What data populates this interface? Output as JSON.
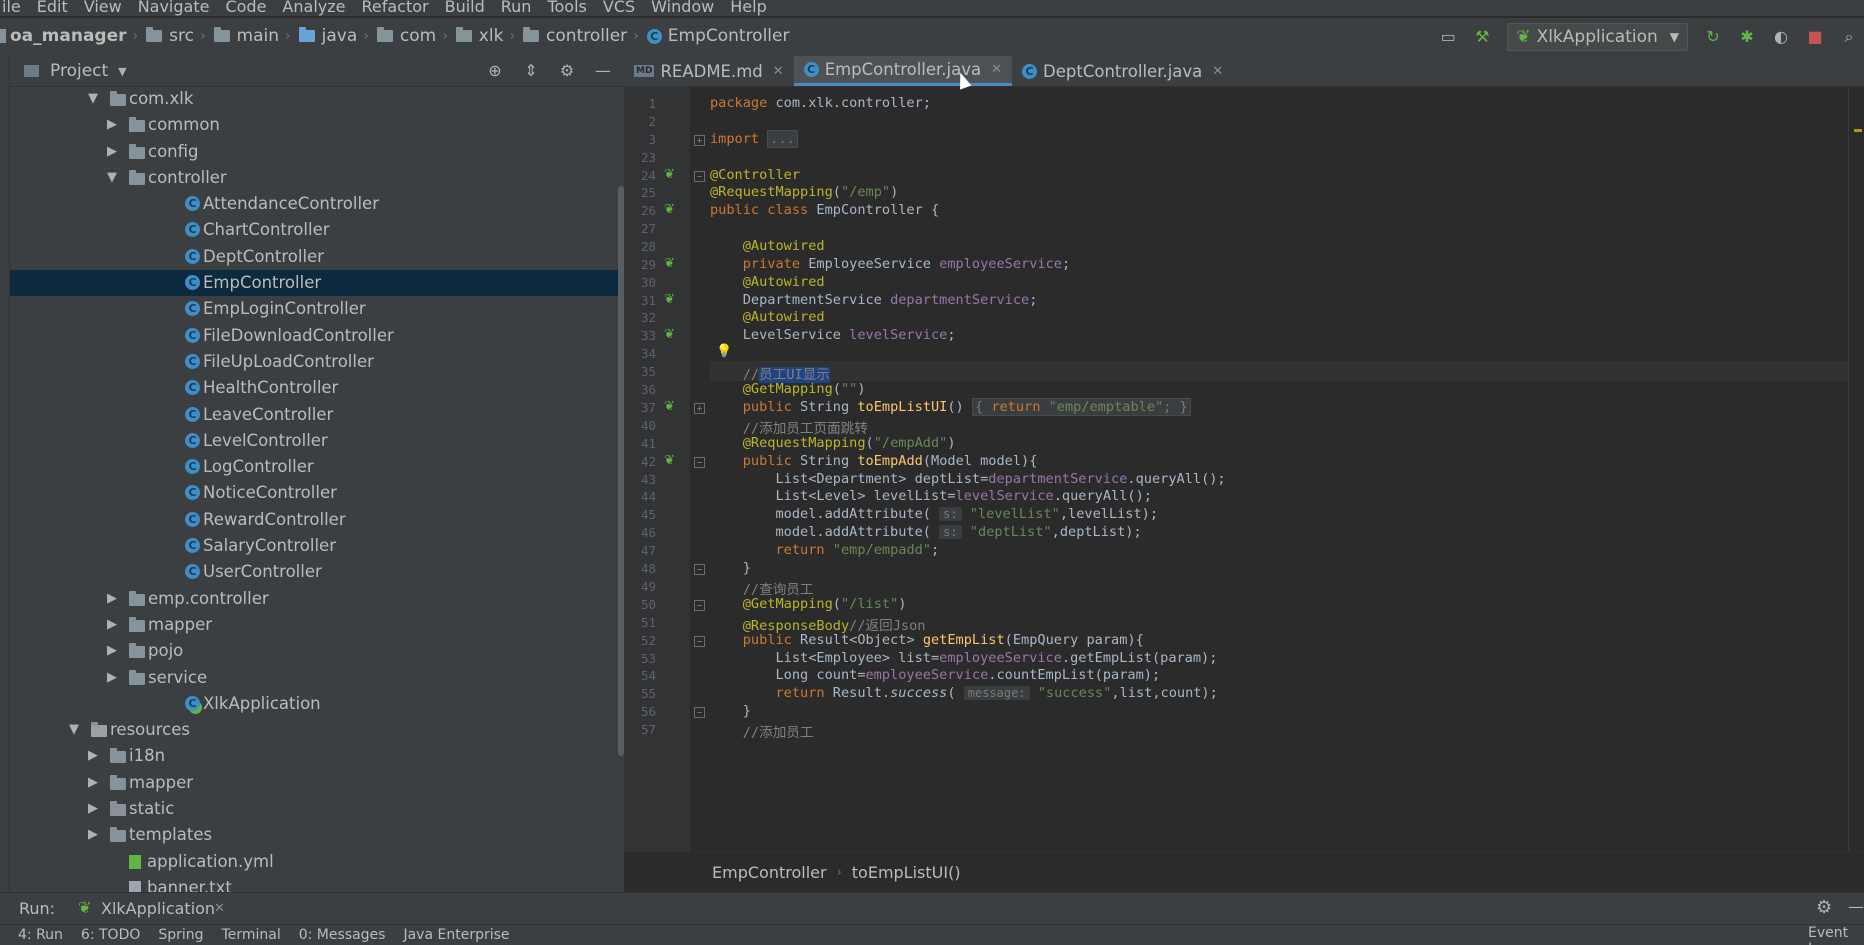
{
  "menu": [
    "ile",
    "Edit",
    "View",
    "Navigate",
    "Code",
    "Analyze",
    "Refactor",
    "Build",
    "Run",
    "Tools",
    "VCS",
    "Window",
    "Help"
  ],
  "breadcrumbs": [
    "oa_manager",
    "src",
    "main",
    "java",
    "com",
    "xlk",
    "controller",
    "EmpController"
  ],
  "run_config": "XlkApplication",
  "project_panel": {
    "title": "Project",
    "tree": [
      {
        "label": "com.xlk",
        "depth": 0,
        "arrow": "▼",
        "icon": "package-icon"
      },
      {
        "label": "common",
        "depth": 1,
        "arrow": "▶",
        "icon": "folder-icon"
      },
      {
        "label": "config",
        "depth": 1,
        "arrow": "▶",
        "icon": "folder-icon"
      },
      {
        "label": "controller",
        "depth": 1,
        "arrow": "▼",
        "icon": "folder-icon"
      },
      {
        "label": "AttendanceController",
        "depth": 2,
        "icon": "class-icon"
      },
      {
        "label": "ChartController",
        "depth": 2,
        "icon": "class-icon"
      },
      {
        "label": "DeptController",
        "depth": 2,
        "icon": "class-icon"
      },
      {
        "label": "EmpController",
        "depth": 2,
        "icon": "class-icon",
        "selected": true
      },
      {
        "label": "EmpLoginController",
        "depth": 2,
        "icon": "class-icon"
      },
      {
        "label": "FileDownloadController",
        "depth": 2,
        "icon": "class-icon"
      },
      {
        "label": "FileUpLoadController",
        "depth": 2,
        "icon": "class-icon"
      },
      {
        "label": "HealthController",
        "depth": 2,
        "icon": "class-icon"
      },
      {
        "label": "LeaveController",
        "depth": 2,
        "icon": "class-icon"
      },
      {
        "label": "LevelController",
        "depth": 2,
        "icon": "class-icon"
      },
      {
        "label": "LogController",
        "depth": 2,
        "icon": "class-icon"
      },
      {
        "label": "NoticeController",
        "depth": 2,
        "icon": "class-icon"
      },
      {
        "label": "RewardController",
        "depth": 2,
        "icon": "class-icon"
      },
      {
        "label": "SalaryController",
        "depth": 2,
        "icon": "class-icon"
      },
      {
        "label": "UserController",
        "depth": 2,
        "icon": "class-icon"
      },
      {
        "label": "emp.controller",
        "depth": 1,
        "arrow": "▶",
        "icon": "folder-icon"
      },
      {
        "label": "mapper",
        "depth": 1,
        "arrow": "▶",
        "icon": "folder-icon"
      },
      {
        "label": "pojo",
        "depth": 1,
        "arrow": "▶",
        "icon": "folder-icon"
      },
      {
        "label": "service",
        "depth": 1,
        "arrow": "▶",
        "icon": "folder-icon"
      },
      {
        "label": "XlkApplication",
        "depth": 2,
        "icon": "spring-class-icon"
      },
      {
        "label": "resources",
        "depth": -1,
        "arrow": "▼",
        "icon": "resources-folder-icon"
      },
      {
        "label": "i18n",
        "depth": 0,
        "arrow": "▶",
        "icon": "folder-icon"
      },
      {
        "label": "mapper",
        "depth": 0,
        "arrow": "▶",
        "icon": "folder-icon"
      },
      {
        "label": "static",
        "depth": 0,
        "arrow": "▶",
        "icon": "folder-icon"
      },
      {
        "label": "templates",
        "depth": 0,
        "arrow": "▶",
        "icon": "folder-icon"
      },
      {
        "label": "application.yml",
        "depth": 1,
        "icon": "yaml-icon"
      },
      {
        "label": "banner.txt",
        "depth": 1,
        "icon": "text-file-icon"
      }
    ]
  },
  "tabs": [
    {
      "label": "README.md",
      "icon": "markdown-icon",
      "active": false
    },
    {
      "label": "EmpController.java",
      "icon": "class-icon",
      "active": true
    },
    {
      "label": "DeptController.java",
      "icon": "class-icon",
      "active": false
    }
  ],
  "code_lines": [
    {
      "n": "1",
      "html": "<span class=\"kw\">package </span>com.xlk.controller;"
    },
    {
      "n": "2",
      "html": ""
    },
    {
      "n": "3",
      "html": "<span class=\"kw\">import </span><span class=\"collapsed\">...</span>",
      "fold": "+"
    },
    {
      "n": "23",
      "html": ""
    },
    {
      "n": "24",
      "html": "<span class=\"an\">@Controller</span>",
      "gutter": "bean",
      "fold": "-"
    },
    {
      "n": "25",
      "html": "<span class=\"an\">@RequestMapping</span>(<span class=\"st\">\"/emp\"</span>)"
    },
    {
      "n": "26",
      "html": "<span class=\"kw\">public class </span>EmpController {",
      "gutter": "bean"
    },
    {
      "n": "27",
      "html": ""
    },
    {
      "n": "28",
      "html": "    <span class=\"an\">@Autowired</span>"
    },
    {
      "n": "29",
      "html": "    <span class=\"kw\">private </span>EmployeeService <span class=\"fd\">employeeService</span>;",
      "gutter": "bean"
    },
    {
      "n": "30",
      "html": "    <span class=\"an\">@Autowired</span>"
    },
    {
      "n": "31",
      "html": "    DepartmentService <span class=\"fd\">departmentService</span>;",
      "gutter": "bean"
    },
    {
      "n": "32",
      "html": "    <span class=\"an\">@Autowired</span>"
    },
    {
      "n": "33",
      "html": "    LevelService <span class=\"fd\">levelService</span>;",
      "gutter": "bean"
    },
    {
      "n": "34",
      "html": "",
      "bulb": true
    },
    {
      "n": "35",
      "html": "    <span class=\"cm\">//<span class=\"sel-text\">员工UI显示</span></span>",
      "current": true
    },
    {
      "n": "36",
      "html": "    <span class=\"an\">@GetMapping</span>(<span class=\"st\">\"\"</span>)"
    },
    {
      "n": "37",
      "html": "    <span class=\"kw\">public </span>String <span class=\"fn\">toEmpListUI</span>() <span class=\"collapsed\">{ <span class=\"kw\">return </span><span class=\"st\">\"emp/emptable\"</span>; }</span>",
      "gutter": "bean",
      "fold": "+"
    },
    {
      "n": "40",
      "html": "    <span class=\"cm\">//添加员工页面跳转</span>"
    },
    {
      "n": "41",
      "html": "    <span class=\"an\">@RequestMapping</span>(<span class=\"st\">\"/empAdd\"</span>)"
    },
    {
      "n": "42",
      "html": "    <span class=\"kw\">public </span>String <span class=\"fn\">toEmpAdd</span>(Model model){",
      "gutter": "bean",
      "fold": "-"
    },
    {
      "n": "43",
      "html": "        List&lt;Department&gt; deptList=<span class=\"fd\">departmentService</span>.queryAll();"
    },
    {
      "n": "44",
      "html": "        List&lt;Level&gt; levelList=<span class=\"fd\">levelService</span>.queryAll();"
    },
    {
      "n": "45",
      "html": "        model.addAttribute( <span class=\"hint\">s:</span> <span class=\"st\">\"levelList\"</span>,levelList);"
    },
    {
      "n": "46",
      "html": "        model.addAttribute( <span class=\"hint\">s:</span> <span class=\"st\">\"deptList\"</span>,deptList);"
    },
    {
      "n": "47",
      "html": "        <span class=\"kw\">return </span><span class=\"st\">\"emp/empadd\"</span>;"
    },
    {
      "n": "48",
      "html": "    }",
      "fold": "-"
    },
    {
      "n": "49",
      "html": "    <span class=\"cm\">//查询员工</span>"
    },
    {
      "n": "50",
      "html": "    <span class=\"an\">@GetMapping</span>(<span class=\"st\">\"/list\"</span>)",
      "fold": "-"
    },
    {
      "n": "51",
      "html": "    <span class=\"an\">@ResponseBody</span><span class=\"cm\">//返回Json</span>"
    },
    {
      "n": "52",
      "html": "    <span class=\"kw\">public </span>Result&lt;Object&gt; <span class=\"fn\">getEmpList</span>(EmpQuery param){",
      "fold": "-"
    },
    {
      "n": "53",
      "html": "        List&lt;Employee&gt; list=<span class=\"fd\">employeeService</span>.getEmpList(param);"
    },
    {
      "n": "54",
      "html": "        Long count=<span class=\"fd\">employeeService</span>.countEmpList(param);"
    },
    {
      "n": "55",
      "html": "        <span class=\"kw\">return </span>Result.<span class=\"it\">success</span>( <span class=\"hint\">message:</span> <span class=\"st\">\"success\"</span>,list,count);"
    },
    {
      "n": "56",
      "html": "    }",
      "fold": "-"
    },
    {
      "n": "57",
      "html": "    <span class=\"cm\">//添加员工</span>"
    }
  ],
  "editor_breadcrumb": [
    "EmpController",
    "toEmpListUI()"
  ],
  "run_panel": {
    "label": "Run:",
    "config": "XlkApplication"
  },
  "bottom_tabs": [
    "4: Run",
    "6: TODO",
    "Spring",
    "Terminal",
    "0: Messages",
    "Java Enterprise",
    "Event Log"
  ]
}
